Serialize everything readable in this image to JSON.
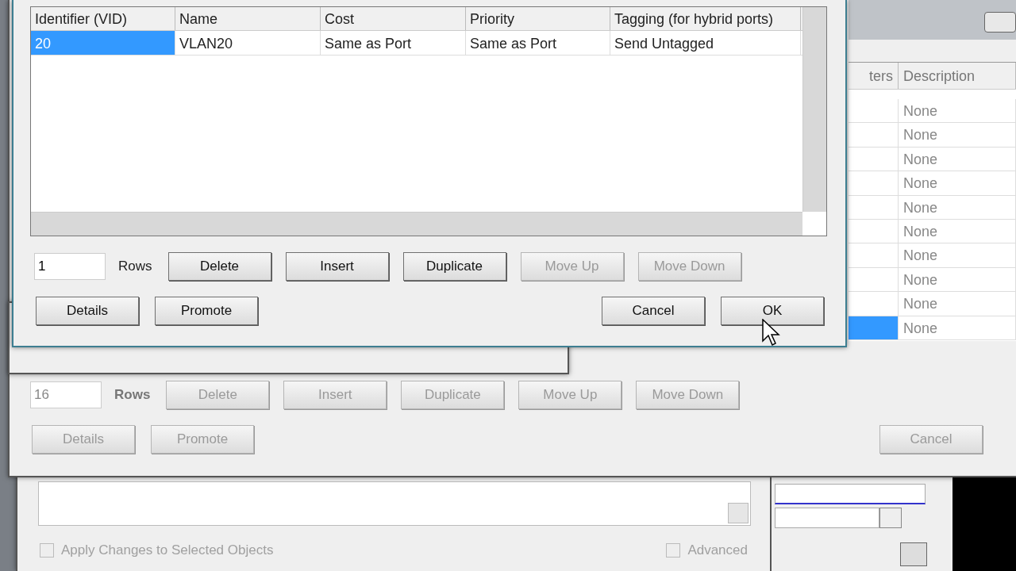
{
  "dialog": {
    "table": {
      "columns": [
        "Identifier (VID)",
        "Name",
        "Cost",
        "Priority",
        "Tagging (for hybrid ports)"
      ],
      "rows": [
        {
          "cells": [
            "20",
            "VLAN20",
            "Same as Port",
            "Same as Port",
            "Send Untagged"
          ],
          "selected": true
        }
      ]
    },
    "rows_field": {
      "value": "1",
      "label": "Rows"
    },
    "buttons": [
      {
        "label": "Delete",
        "disabled": false
      },
      {
        "label": "Insert",
        "disabled": false
      },
      {
        "label": "Duplicate",
        "disabled": false
      },
      {
        "label": "Move Up",
        "disabled": true
      },
      {
        "label": "Move Down",
        "disabled": true
      }
    ],
    "left_buttons": [
      {
        "label": "Details",
        "disabled": false
      },
      {
        "label": "Promote",
        "disabled": false
      }
    ],
    "right_buttons": [
      {
        "label": "Cancel",
        "disabled": false
      },
      {
        "label": "OK",
        "disabled": false
      }
    ]
  },
  "background_window": {
    "table": {
      "columns": [
        "ters",
        "Description"
      ],
      "rows": [
        {
          "cells": [
            "",
            "None"
          ],
          "selected": false
        },
        {
          "cells": [
            "",
            "None"
          ],
          "selected": false
        },
        {
          "cells": [
            "",
            "None"
          ],
          "selected": false
        },
        {
          "cells": [
            "",
            "None"
          ],
          "selected": false
        },
        {
          "cells": [
            "",
            "None"
          ],
          "selected": false
        },
        {
          "cells": [
            "",
            "None"
          ],
          "selected": false
        },
        {
          "cells": [
            "",
            "None"
          ],
          "selected": false
        },
        {
          "cells": [
            "",
            "None"
          ],
          "selected": false
        },
        {
          "cells": [
            "",
            "None"
          ],
          "selected": false
        },
        {
          "cells": [
            "",
            "None"
          ],
          "selected": true
        }
      ]
    },
    "rows_field": {
      "value": "16",
      "label": "Rows"
    },
    "buttons": [
      {
        "label": "Delete",
        "disabled": true
      },
      {
        "label": "Insert",
        "disabled": true
      },
      {
        "label": "Duplicate",
        "disabled": true
      },
      {
        "label": "Move Up",
        "disabled": true
      },
      {
        "label": "Move Down",
        "disabled": true
      }
    ],
    "left_buttons": [
      {
        "label": "Details",
        "disabled": true
      },
      {
        "label": "Promote",
        "disabled": true
      }
    ],
    "right_buttons": [
      {
        "label": "Cancel",
        "disabled": true
      }
    ]
  },
  "bottom_panel": {
    "checkboxes": [
      {
        "label": "Apply Changes to Selected Objects",
        "checked": false,
        "disabled": true
      },
      {
        "label": "Advanced",
        "checked": false,
        "disabled": true
      }
    ]
  }
}
